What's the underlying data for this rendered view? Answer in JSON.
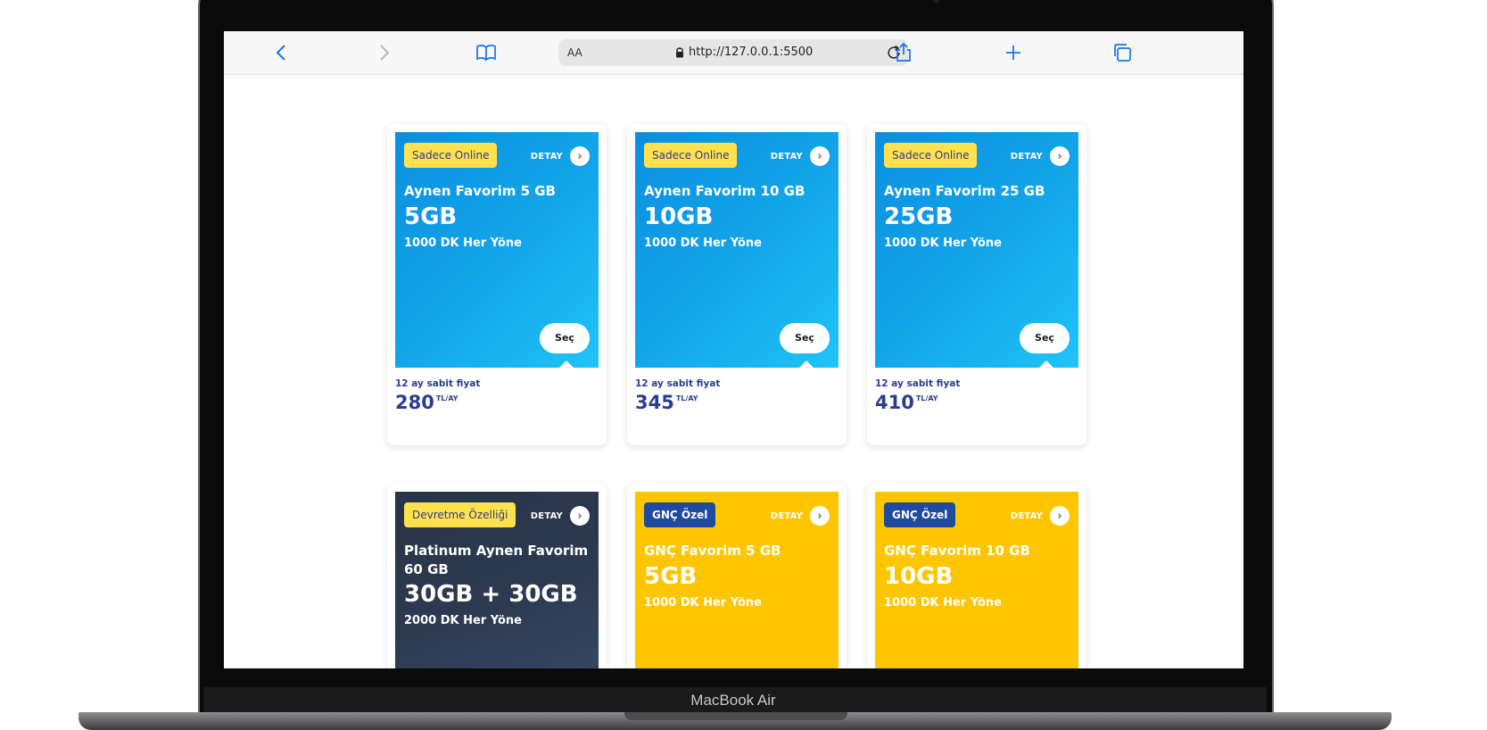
{
  "device": {
    "label": "MacBook Air"
  },
  "browser": {
    "text_size": "AA",
    "url": "http://127.0.0.1:5500",
    "icons": [
      "back-chevron-icon",
      "forward-chevron-icon",
      "bookmarks-icon",
      "lock-icon",
      "reload-icon",
      "share-icon",
      "new-tab-icon",
      "tabs-icon"
    ]
  },
  "colors": {
    "accent_blue": "#0a8fe0",
    "brand_yellow": "#ffc600",
    "dark_card": "#283447",
    "price_navy": "#2a3d8f",
    "badge_yellow": "#ffe14d",
    "badge_navy": "#1e4aa0"
  },
  "cards": [
    {
      "badge": "Sadece Online",
      "detay": "DETAY",
      "name": "Aynen Favorim 5 GB",
      "data": "5GB",
      "minutes": "1000 DK Her Yöne",
      "select": "Seç",
      "fixed": "12 ay sabit fiyat",
      "price": "280",
      "unit": "TL/AY"
    },
    {
      "badge": "Sadece Online",
      "detay": "DETAY",
      "name": "Aynen Favorim 10 GB",
      "data": "10GB",
      "minutes": "1000 DK Her Yöne",
      "select": "Seç",
      "fixed": "12 ay sabit fiyat",
      "price": "345",
      "unit": "TL/AY"
    },
    {
      "badge": "Sadece Online",
      "detay": "DETAY",
      "name": "Aynen Favorim 25 GB",
      "data": "25GB",
      "minutes": "1000 DK Her Yöne",
      "select": "Seç",
      "fixed": "12 ay sabit fiyat",
      "price": "410",
      "unit": "TL/AY"
    },
    {
      "badge": "Devretme Özelliği",
      "detay": "DETAY",
      "name": "Platinum Aynen Favorim 60 GB",
      "data": "30GB + 30GB",
      "minutes": "2000 DK Her Yöne"
    },
    {
      "badge": "GNÇ Özel",
      "detay": "DETAY",
      "name": "GNÇ Favorim 5 GB",
      "data": "5GB",
      "minutes": "1000 DK Her Yöne"
    },
    {
      "badge": "GNÇ Özel",
      "detay": "DETAY",
      "name": "GNÇ Favorim 10 GB",
      "data": "10GB",
      "minutes": "1000 DK Her Yöne"
    }
  ]
}
